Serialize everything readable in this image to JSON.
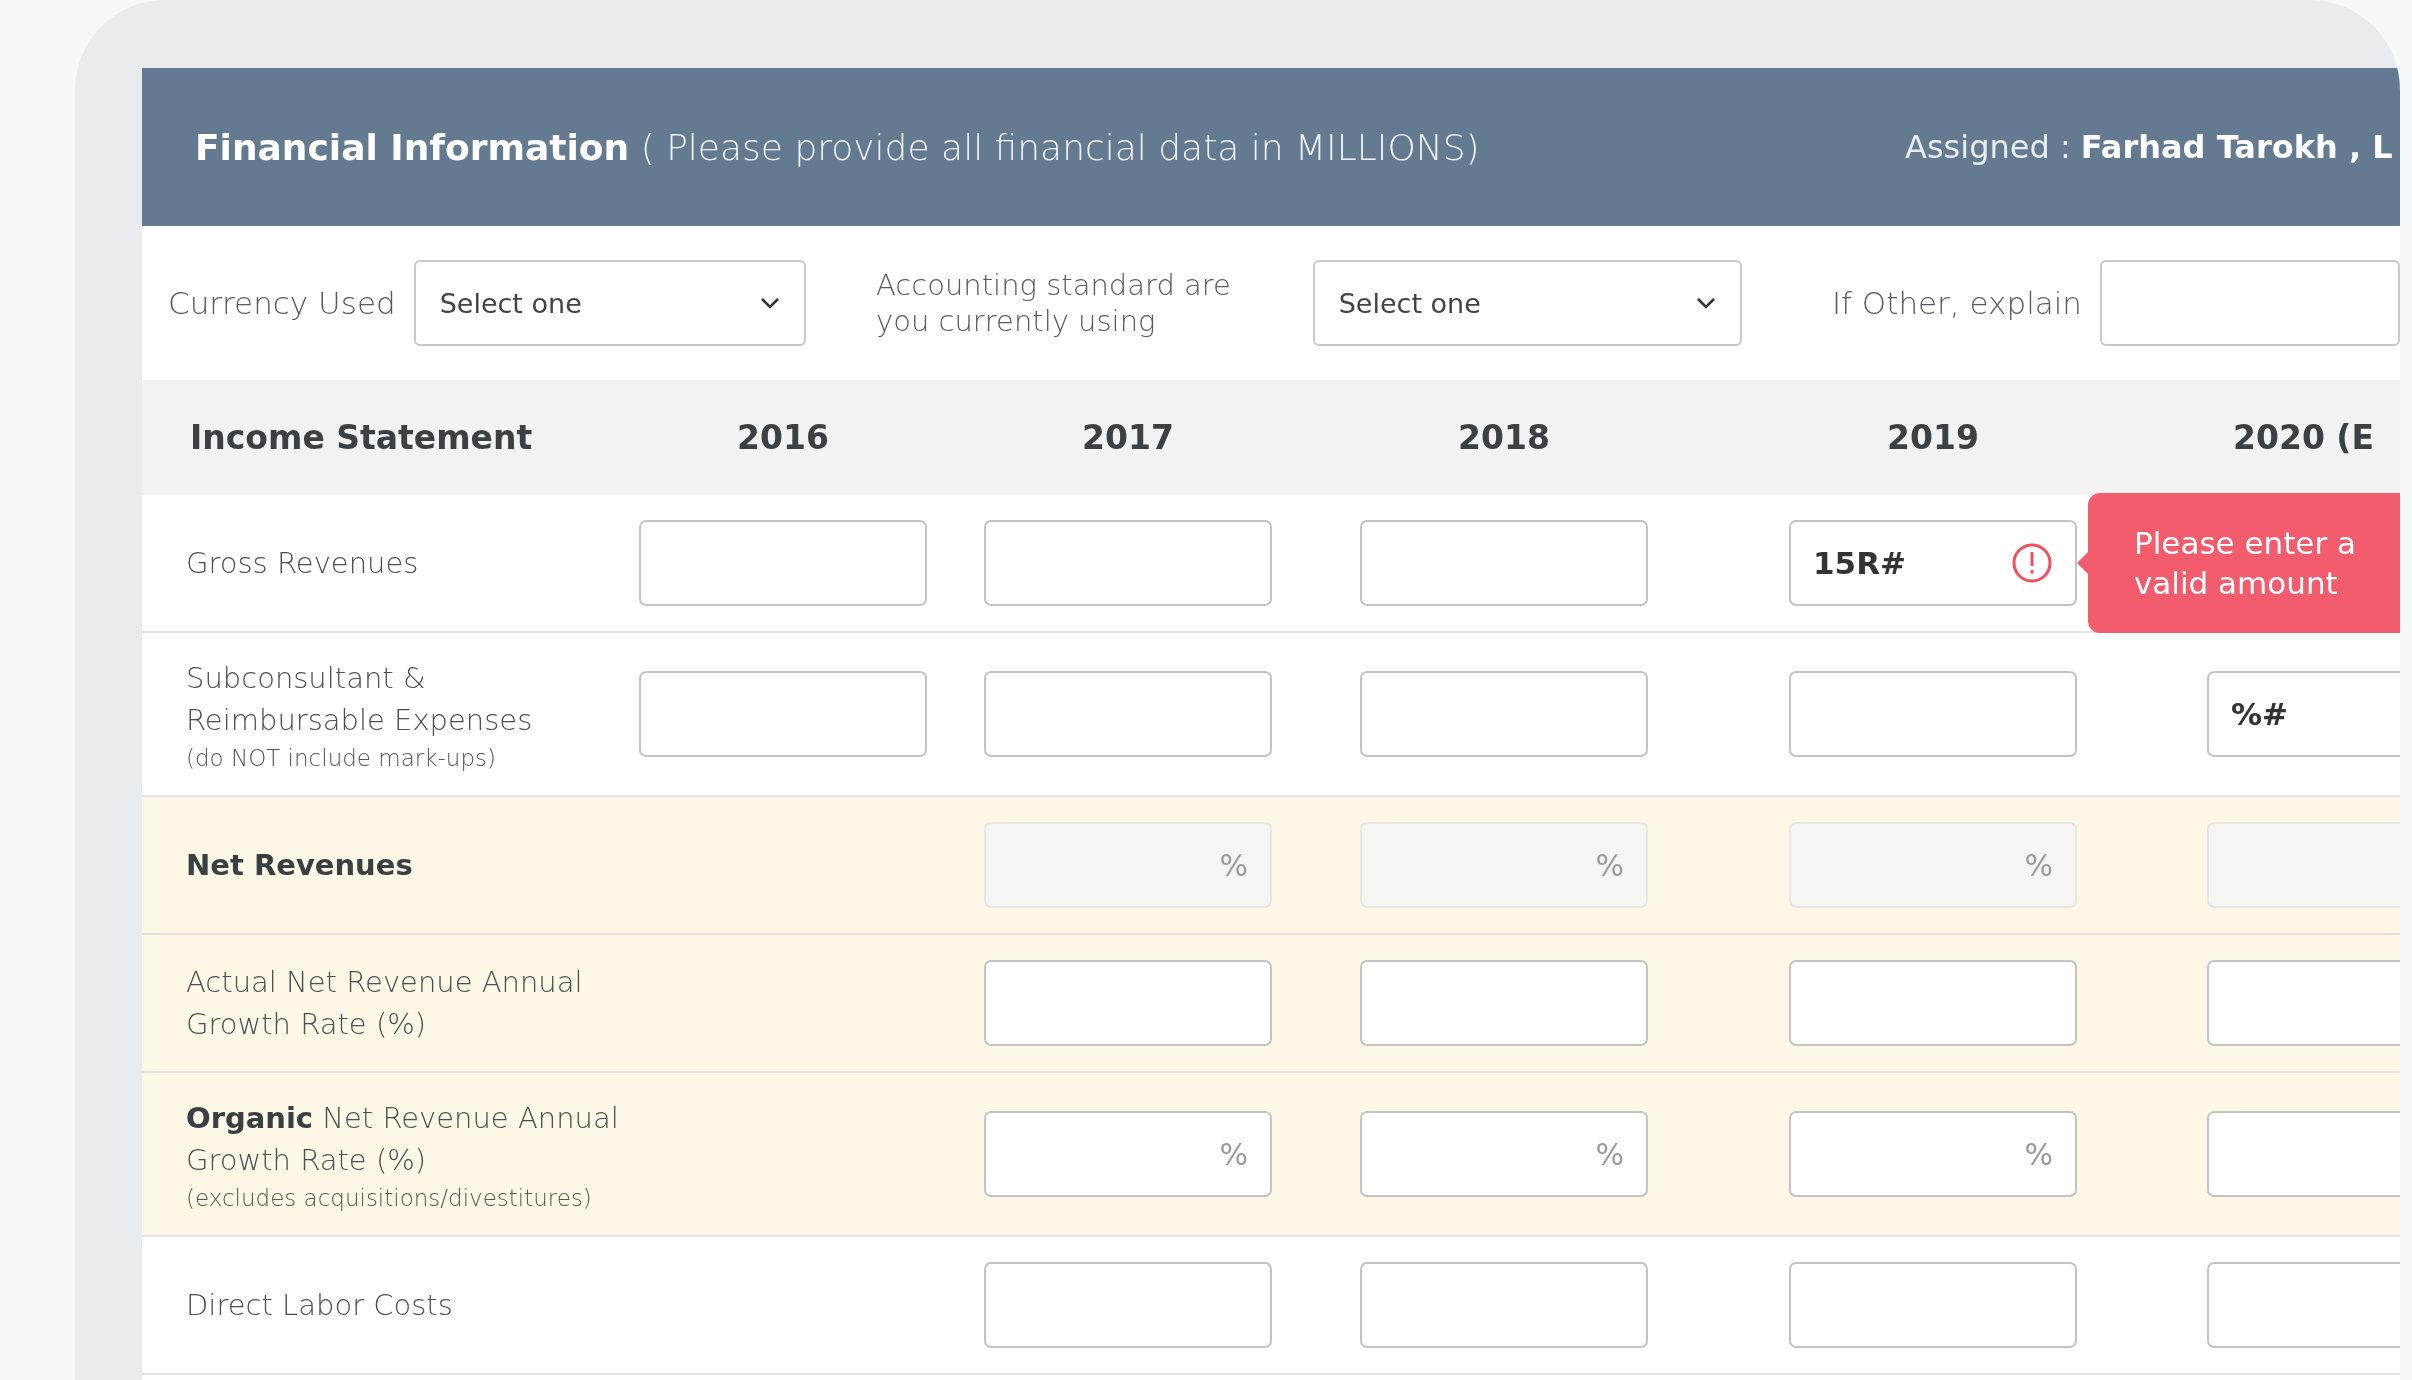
{
  "header": {
    "title": "Financial Information",
    "note": "( Please provide all financial data in MILLIONS)",
    "assigned": "Assigned :  **Farhad Tarokh , L**"
  },
  "form": [
    {
      "kind": "select",
      "label": "Currency Used",
      "placeholder": "Select one"
    },
    {
      "kind": "select",
      "label": "Accounting standard are you currently using",
      "placeholder": "Select one"
    },
    {
      "kind": "text",
      "label": "If Other, explain"
    }
  ],
  "table": {
    "title": "Income Statement",
    "columns": [
      "2016",
      "2017",
      "2018",
      "2019",
      "2020 (E"
    ],
    "rows": [
      {
        "label": "Gross Revenues",
        "highlighted": false,
        "cells": [
          {
            "kind": "input"
          },
          {
            "kind": "input"
          },
          {
            "kind": "input"
          },
          {
            "kind": "input",
            "value": "15R#",
            "invalid": true,
            "tooltip": "Please enter a valid amount"
          },
          {
            "kind": "covered"
          }
        ]
      },
      {
        "label": "Subconsultant & Reimbursable Expenses",
        "note": "(do NOT include mark-ups)",
        "highlighted": false,
        "cells": [
          {
            "kind": "input"
          },
          {
            "kind": "input"
          },
          {
            "kind": "input"
          },
          {
            "kind": "input"
          },
          {
            "kind": "input",
            "value": "%#"
          }
        ]
      },
      {
        "label": "**Net Revenues**",
        "highlighted": true,
        "cells": [
          {
            "kind": "empty"
          },
          {
            "kind": "input",
            "disabled": true,
            "suffix": "%"
          },
          {
            "kind": "input",
            "disabled": true,
            "suffix": "%"
          },
          {
            "kind": "input",
            "disabled": true,
            "suffix": "%"
          },
          {
            "kind": "input",
            "disabled": true
          }
        ]
      },
      {
        "label": "Actual Net Revenue Annual Growth Rate (%)",
        "highlighted": true,
        "cells": [
          {
            "kind": "empty"
          },
          {
            "kind": "input"
          },
          {
            "kind": "input"
          },
          {
            "kind": "input"
          },
          {
            "kind": "input"
          }
        ]
      },
      {
        "label": "**Organic** Net Revenue Annual Growth Rate (%)",
        "note": "(excludes acquisitions/divestitures)",
        "highlighted": true,
        "cells": [
          {
            "kind": "empty"
          },
          {
            "kind": "input",
            "suffix": "%"
          },
          {
            "kind": "input",
            "suffix": "%"
          },
          {
            "kind": "input",
            "suffix": "%"
          },
          {
            "kind": "input"
          }
        ]
      },
      {
        "label": "Direct Labor Costs",
        "highlighted": false,
        "cells": [
          {
            "kind": "empty"
          },
          {
            "kind": "input"
          },
          {
            "kind": "input"
          },
          {
            "kind": "input"
          },
          {
            "kind": "input"
          }
        ]
      }
    ]
  }
}
